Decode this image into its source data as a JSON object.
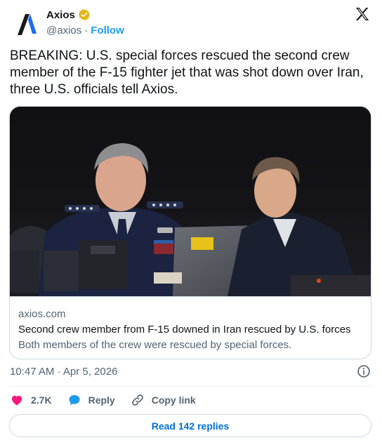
{
  "account": {
    "display_name": "Axios",
    "handle": "@axios",
    "separator": "·",
    "follow_label": "Follow",
    "verified_color": "#e2b719"
  },
  "tweet": {
    "text": "BREAKING: U.S. special forces rescued the second crew member of the F-15 fighter jet that was shot down over Iran, three U.S. officials tell Axios."
  },
  "card": {
    "domain": "axios.com",
    "title": "Second crew member from F-15 downed in Iran rescued by U.S. forces",
    "description": "Both members of the crew were rescued by special forces."
  },
  "meta": {
    "timestamp": "10:47 AM · Apr 5, 2026"
  },
  "actions": {
    "like_count": "2.7K",
    "reply_label": "Reply",
    "copy_link_label": "Copy link"
  },
  "footer": {
    "read_replies_label": "Read 142 replies"
  },
  "colors": {
    "like": "#f91880",
    "reply": "#1d9bf0",
    "link": "#006fd6",
    "muted": "#536471"
  }
}
